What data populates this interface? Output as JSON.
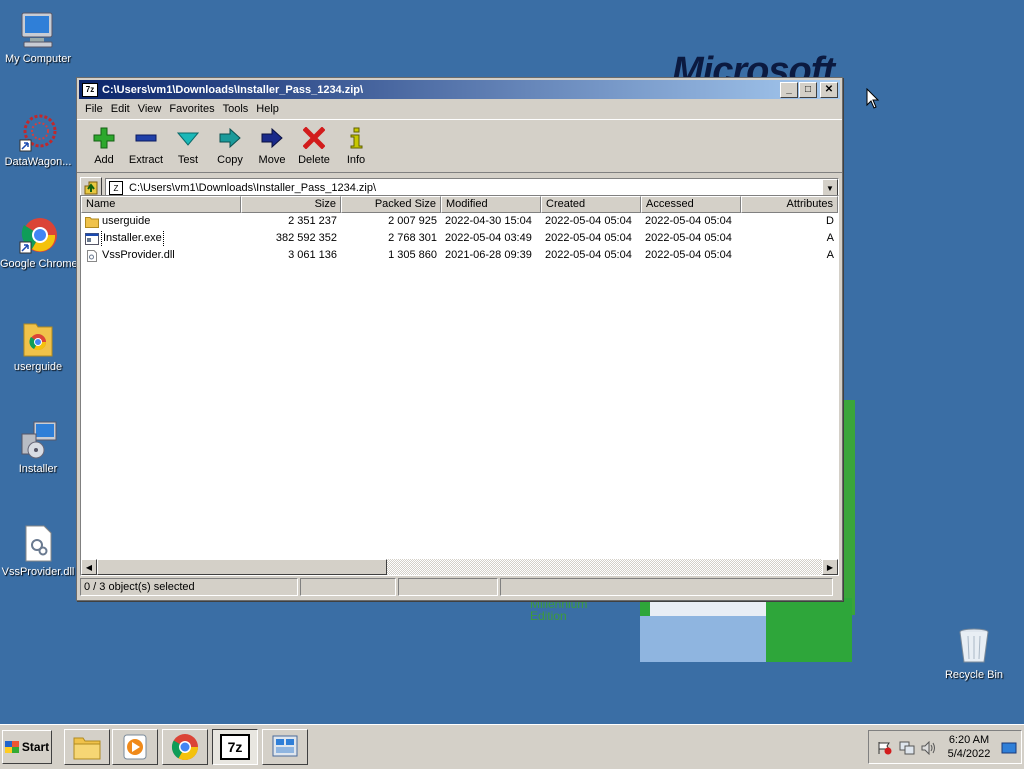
{
  "desktop": {
    "icons": [
      {
        "label": "My Computer"
      },
      {
        "label": "DataWagon..."
      },
      {
        "label": "Google Chrome"
      },
      {
        "label": "userguide"
      },
      {
        "label": "Installer"
      },
      {
        "label": "VssProvider.dll"
      },
      {
        "label": "Recycle Bin"
      }
    ],
    "wallpaper_logo": "Microsoft",
    "wallpaper_edition_1": "Millennium",
    "wallpaper_edition_2": "Edition"
  },
  "window": {
    "title": "C:\\Users\\vm1\\Downloads\\Installer_Pass_1234.zip\\",
    "app_icon": "7z",
    "menu": [
      "File",
      "Edit",
      "View",
      "Favorites",
      "Tools",
      "Help"
    ],
    "toolbar": [
      {
        "label": "Add",
        "icon": "plus-icon",
        "color": "#2da82d"
      },
      {
        "label": "Extract",
        "icon": "minus-icon",
        "color": "#1f3fa8"
      },
      {
        "label": "Test",
        "icon": "check-icon",
        "color": "#1aa8a8"
      },
      {
        "label": "Copy",
        "icon": "copy-arrow-icon",
        "color": "#1a8a8a"
      },
      {
        "label": "Move",
        "icon": "move-arrow-icon",
        "color": "#1a2a8a"
      },
      {
        "label": "Delete",
        "icon": "delete-x-icon",
        "color": "#d21c1c"
      },
      {
        "label": "Info",
        "icon": "info-icon",
        "color": "#c8c800"
      }
    ],
    "address": "C:\\Users\\vm1\\Downloads\\Installer_Pass_1234.zip\\",
    "columns": [
      "Name",
      "Size",
      "Packed Size",
      "Modified",
      "Created",
      "Accessed",
      "Attributes"
    ],
    "rows": [
      {
        "type": "folder",
        "name": "userguide",
        "size": "2 351 237",
        "packed": "2 007 925",
        "modified": "2022-04-30 15:04",
        "created": "2022-05-04 05:04",
        "accessed": "2022-05-04 05:04",
        "attr": "D"
      },
      {
        "type": "exe",
        "name": "Installer.exe",
        "size": "382 592 352",
        "packed": "2 768 301",
        "modified": "2022-05-04 03:49",
        "created": "2022-05-04 05:04",
        "accessed": "2022-05-04 05:04",
        "attr": "A"
      },
      {
        "type": "dll",
        "name": "VssProvider.dll",
        "size": "3 061 136",
        "packed": "1 305 860",
        "modified": "2021-06-28 09:39",
        "created": "2022-05-04 05:04",
        "accessed": "2022-05-04 05:04",
        "attr": "A"
      }
    ],
    "status": "0 / 3 object(s) selected"
  },
  "taskbar": {
    "start_label": "Start",
    "clock_time": "6:20 AM",
    "clock_date": "5/4/2022",
    "seven_zip_label": "7z"
  }
}
